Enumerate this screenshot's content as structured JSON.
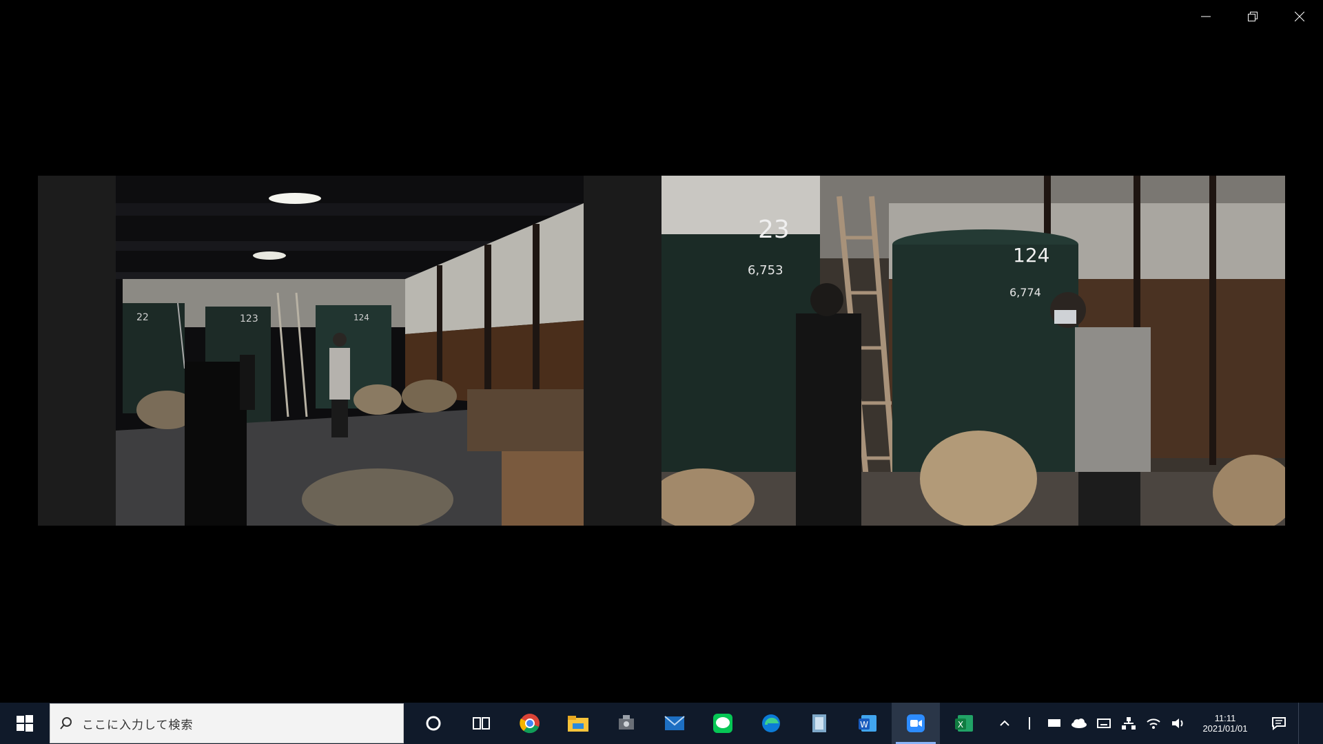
{
  "window": {
    "controls": [
      "minimize",
      "restore",
      "close"
    ]
  },
  "videos": [
    {
      "scene": "warehouse-wide"
    },
    {
      "scene": "warehouse-closeup"
    }
  ],
  "taskbar": {
    "search_text": "ここに入力して検索",
    "apps": [
      {
        "icon": "cortana-icon"
      },
      {
        "icon": "task-view-icon"
      },
      {
        "icon": "chrome-icon"
      },
      {
        "icon": "file-explorer-icon"
      },
      {
        "icon": "utility-icon"
      },
      {
        "icon": "mail-icon"
      },
      {
        "icon": "line-icon"
      },
      {
        "icon": "edge-icon"
      },
      {
        "icon": "windows-explorer-icon"
      },
      {
        "icon": "word-icon"
      },
      {
        "icon": "zoom-icon"
      },
      {
        "icon": "excel-icon"
      }
    ],
    "clock": {
      "time": "11:11",
      "date": "2021/01/01"
    }
  },
  "colors": {
    "taskbar_bg": "#101a2a",
    "active_underline": "#8ab4f8"
  }
}
